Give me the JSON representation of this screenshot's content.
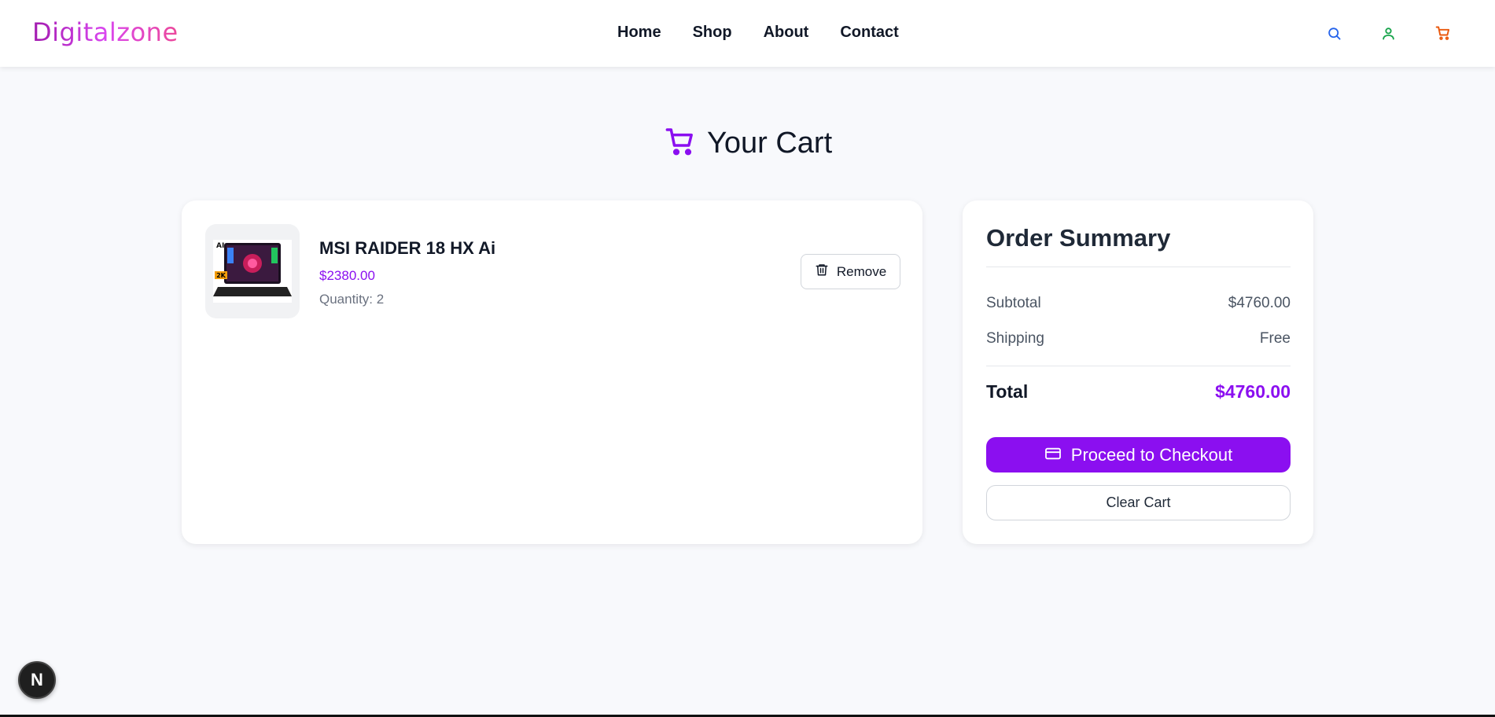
{
  "header": {
    "logo": "Digitalzone",
    "nav": [
      "Home",
      "Shop",
      "About",
      "Contact"
    ],
    "icons": [
      "search-icon",
      "user-icon",
      "cart-icon"
    ]
  },
  "page": {
    "title": "Your Cart"
  },
  "cart": {
    "items": [
      {
        "name": "MSI RAIDER 18 HX Ai",
        "price": "$2380.00",
        "quantity": "Quantity: 2",
        "remove_label": "Remove"
      }
    ]
  },
  "summary": {
    "title": "Order Summary",
    "subtotal_label": "Subtotal",
    "subtotal_value": "$4760.00",
    "shipping_label": "Shipping",
    "shipping_value": "Free",
    "total_label": "Total",
    "total_value": "$4760.00",
    "checkout_label": "Proceed to Checkout",
    "clear_label": "Clear Cart"
  },
  "badge": "N",
  "colors": {
    "accent": "#8b0ff0",
    "search_icon": "#2563eb",
    "user_icon": "#16a34a",
    "cart_icon": "#ea580c"
  }
}
